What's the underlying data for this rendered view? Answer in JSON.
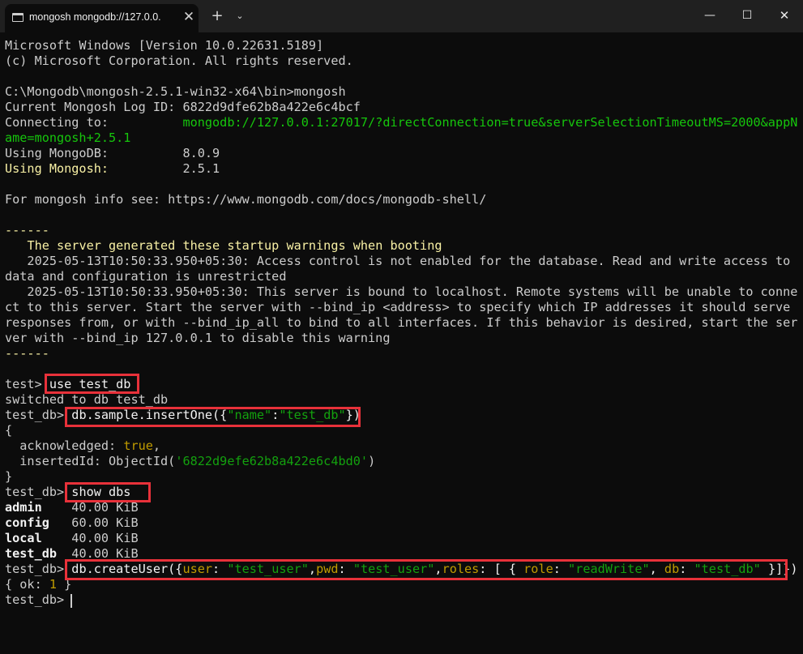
{
  "window": {
    "tab_title": "mongosh mongodb://127.0.0.",
    "tab_icon": "terminal-icon",
    "close_tab_label": "✕",
    "new_tab_label": "+",
    "dropdown_label": "⌄",
    "minimize_label": "—",
    "maximize_label": "☐",
    "close_label": "✕"
  },
  "colors": {
    "background": "#0c0c0c",
    "titlebar": "#202020",
    "text": "#cccccc",
    "green": "#16c60c",
    "yellow": "#f9f1a5",
    "string": "#13a10e",
    "key": "#c19c00",
    "highlight_box": "#e8313a"
  },
  "lines": [
    [
      {
        "t": "Microsoft Windows [Version 10.0.22631.5189]"
      }
    ],
    [
      {
        "t": "(c) Microsoft Corporation. All rights reserved."
      }
    ],
    [
      {
        "t": ""
      }
    ],
    [
      {
        "t": "C:\\Mongodb\\mongosh-2.5.1-win32-x64\\bin>mongosh"
      }
    ],
    [
      {
        "t": "Current Mongosh Log ID: 6822d9dfe62b8a422e6c4bcf"
      }
    ],
    [
      {
        "t": "Connecting to:          "
      },
      {
        "t": "mongodb://127.0.0.1:27017/?directConnection=true&serverSelectionTimeoutMS=2000&appN",
        "c": "green"
      }
    ],
    [
      {
        "t": "ame=mongosh+2.5.1",
        "c": "green"
      }
    ],
    [
      {
        "t": "Using MongoDB:          8.0.9"
      }
    ],
    [
      {
        "t": "Using Mongosh:",
        "c": "yellow"
      },
      {
        "t": "          2.5.1"
      }
    ],
    [
      {
        "t": ""
      }
    ],
    [
      {
        "t": "For mongosh info see: https://www.mongodb.com/docs/mongodb-shell/"
      }
    ],
    [
      {
        "t": ""
      }
    ],
    [
      {
        "t": "------",
        "c": "yellow"
      }
    ],
    [
      {
        "t": "   "
      },
      {
        "t": "The server generated these startup warnings when booting",
        "c": "yellow"
      }
    ],
    [
      {
        "t": "   2025-05-13T10:50:33.950+05:30: Access control is not enabled for the database. Read and write access to"
      }
    ],
    [
      {
        "t": "data and configuration is unrestricted"
      }
    ],
    [
      {
        "t": "   2025-05-13T10:50:33.950+05:30: This server is bound to localhost. Remote systems will be unable to conne"
      }
    ],
    [
      {
        "t": "ct to this server. Start the server with --bind_ip <address> to specify which IP addresses it should serve"
      }
    ],
    [
      {
        "t": "responses from, or with --bind_ip_all to bind to all interfaces. If this behavior is desired, start the ser"
      }
    ],
    [
      {
        "t": "ver with --bind_ip 127.0.0.1 to disable this warning"
      }
    ],
    [
      {
        "t": "------",
        "c": "yellow"
      }
    ],
    [
      {
        "t": ""
      }
    ],
    [
      {
        "t": "test> "
      },
      {
        "t": "use test_db",
        "c": "bright"
      }
    ],
    [
      {
        "t": "switched to db test_db"
      }
    ],
    [
      {
        "t": "test_db> "
      },
      {
        "t": "db.sample.insertOne({",
        "c": "bright"
      },
      {
        "t": "\"name\"",
        "c": "string"
      },
      {
        "t": ":",
        "c": "bright"
      },
      {
        "t": "\"test_db\"",
        "c": "string"
      },
      {
        "t": "})",
        "c": "bright"
      }
    ],
    [
      {
        "t": "{"
      }
    ],
    [
      {
        "t": "  acknowledged: "
      },
      {
        "t": "true",
        "c": "key"
      },
      {
        "t": ","
      }
    ],
    [
      {
        "t": "  insertedId: ObjectId("
      },
      {
        "t": "'6822d9efe62b8a422e6c4bd0'",
        "c": "string"
      },
      {
        "t": ")"
      }
    ],
    [
      {
        "t": "}"
      }
    ],
    [
      {
        "t": "test_db> "
      },
      {
        "t": "show dbs",
        "c": "bright"
      }
    ],
    [
      {
        "t": "admin",
        "c": "bold"
      },
      {
        "t": "    40.00 KiB"
      }
    ],
    [
      {
        "t": "config",
        "c": "bold"
      },
      {
        "t": "   60.00 KiB"
      }
    ],
    [
      {
        "t": "local",
        "c": "bold"
      },
      {
        "t": "    40.00 KiB"
      }
    ],
    [
      {
        "t": "test_db",
        "c": "bold"
      },
      {
        "t": "  40.00 KiB"
      }
    ],
    [
      {
        "t": "test_db> "
      },
      {
        "t": "db.createUser({",
        "c": "bright"
      },
      {
        "t": "user",
        "c": "key"
      },
      {
        "t": ": ",
        "c": "bright"
      },
      {
        "t": "\"test_user\"",
        "c": "string"
      },
      {
        "t": ",",
        "c": "bright"
      },
      {
        "t": "pwd",
        "c": "key"
      },
      {
        "t": ": ",
        "c": "bright"
      },
      {
        "t": "\"test_user\"",
        "c": "string"
      },
      {
        "t": ",",
        "c": "bright"
      },
      {
        "t": "roles",
        "c": "key"
      },
      {
        "t": ": [ { ",
        "c": "bright"
      },
      {
        "t": "role",
        "c": "key"
      },
      {
        "t": ": ",
        "c": "bright"
      },
      {
        "t": "\"readWrite\"",
        "c": "string"
      },
      {
        "t": ", ",
        "c": "bright"
      },
      {
        "t": "db",
        "c": "key"
      },
      {
        "t": ": ",
        "c": "bright"
      },
      {
        "t": "\"test_db\"",
        "c": "string"
      },
      {
        "t": " }]})",
        "c": "bright"
      }
    ],
    [
      {
        "t": "{ ok: "
      },
      {
        "t": "1",
        "c": "key"
      },
      {
        "t": " }"
      }
    ],
    [
      {
        "t": "test_db> "
      }
    ]
  ]
}
